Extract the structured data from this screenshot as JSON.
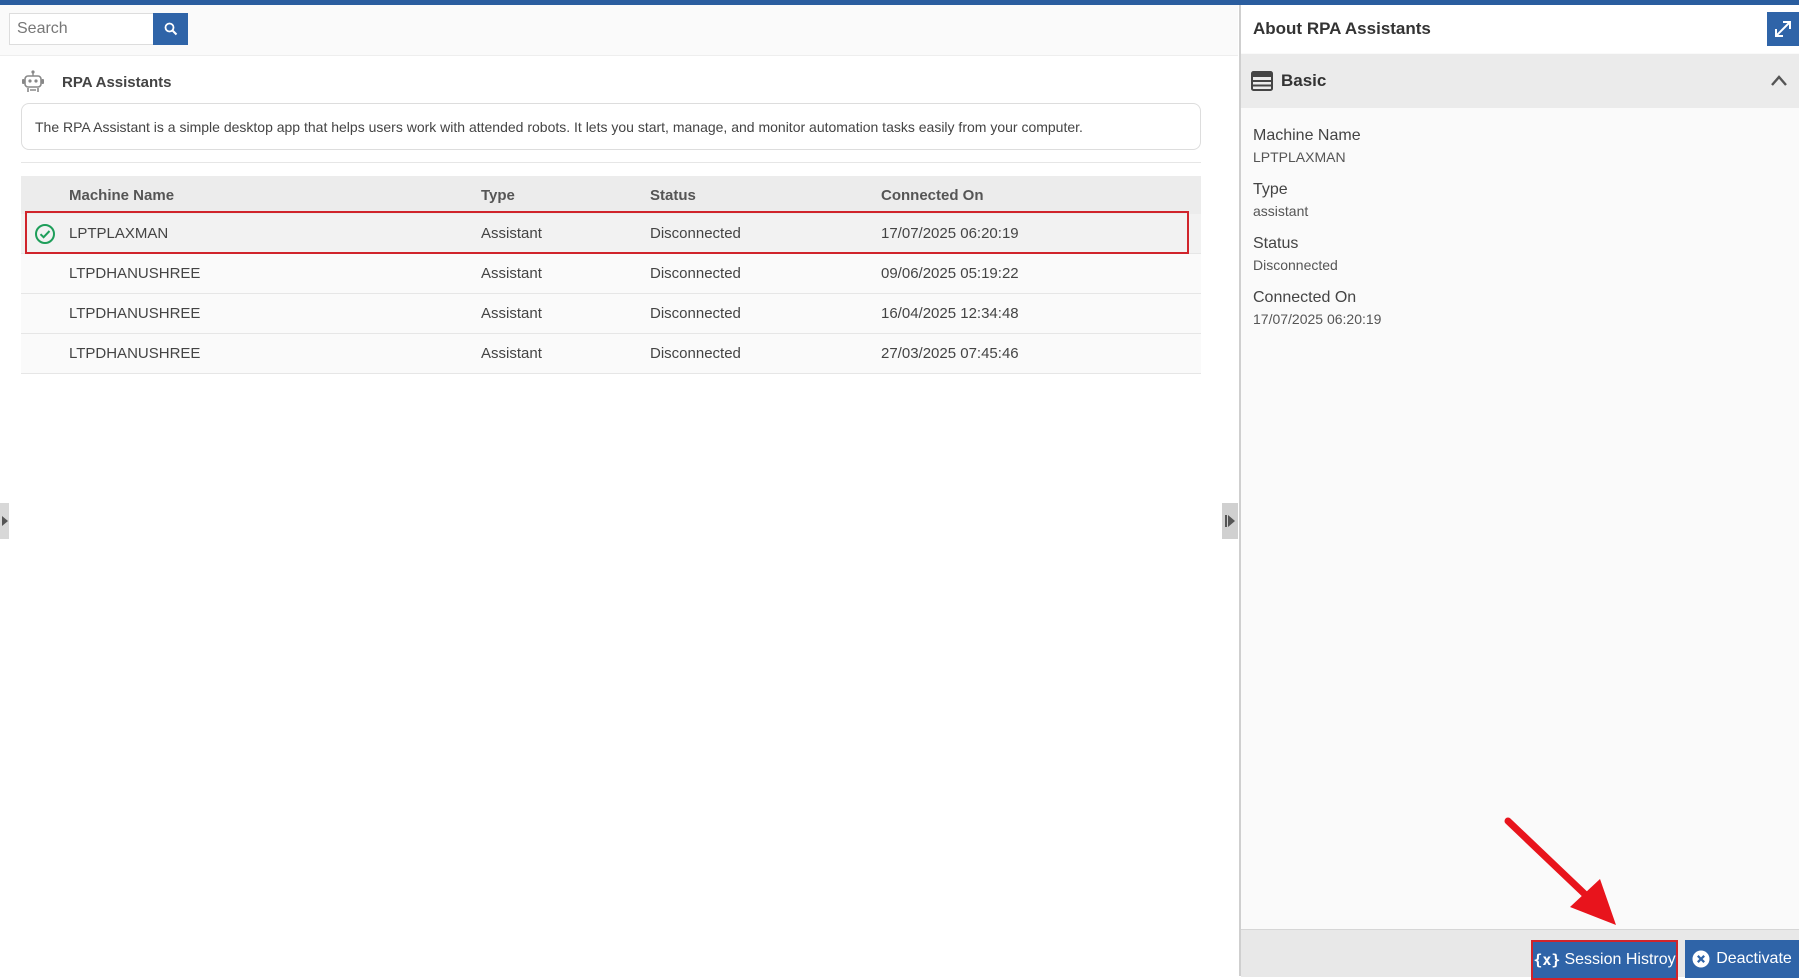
{
  "search": {
    "placeholder": "Search"
  },
  "section": {
    "title": "RPA Assistants"
  },
  "description": "The RPA Assistant is a simple desktop app that helps users work with attended robots. It lets you start, manage, and monitor automation tasks easily from your computer.",
  "table": {
    "headers": {
      "name": "Machine Name",
      "type": "Type",
      "status": "Status",
      "connected": "Connected On"
    },
    "rows": [
      {
        "name": "LPTPLAXMAN",
        "type": "Assistant",
        "status": "Disconnected",
        "connected": "17/07/2025 06:20:19",
        "selected": true
      },
      {
        "name": "LTPDHANUSHREE",
        "type": "Assistant",
        "status": "Disconnected",
        "connected": "09/06/2025 05:19:22"
      },
      {
        "name": "LTPDHANUSHREE",
        "type": "Assistant",
        "status": "Disconnected",
        "connected": "16/04/2025 12:34:48"
      },
      {
        "name": "LTPDHANUSHREE",
        "type": "Assistant",
        "status": "Disconnected",
        "connected": "27/03/2025 07:45:46"
      }
    ]
  },
  "details": {
    "title": "About RPA Assistants",
    "section": "Basic",
    "fields": [
      {
        "label": "Machine Name",
        "value": "LPTPLAXMAN"
      },
      {
        "label": "Type",
        "value": "assistant"
      },
      {
        "label": "Status",
        "value": "Disconnected"
      },
      {
        "label": "Connected On",
        "value": "17/07/2025 06:20:19"
      }
    ]
  },
  "footer": {
    "session_icon": "{x}",
    "session_label": "Session Histroy",
    "deactivate_label": "Deactivate"
  },
  "colors": {
    "accent": "#2f64a8",
    "highlight": "#d0242b",
    "success": "#1e9e5a"
  }
}
